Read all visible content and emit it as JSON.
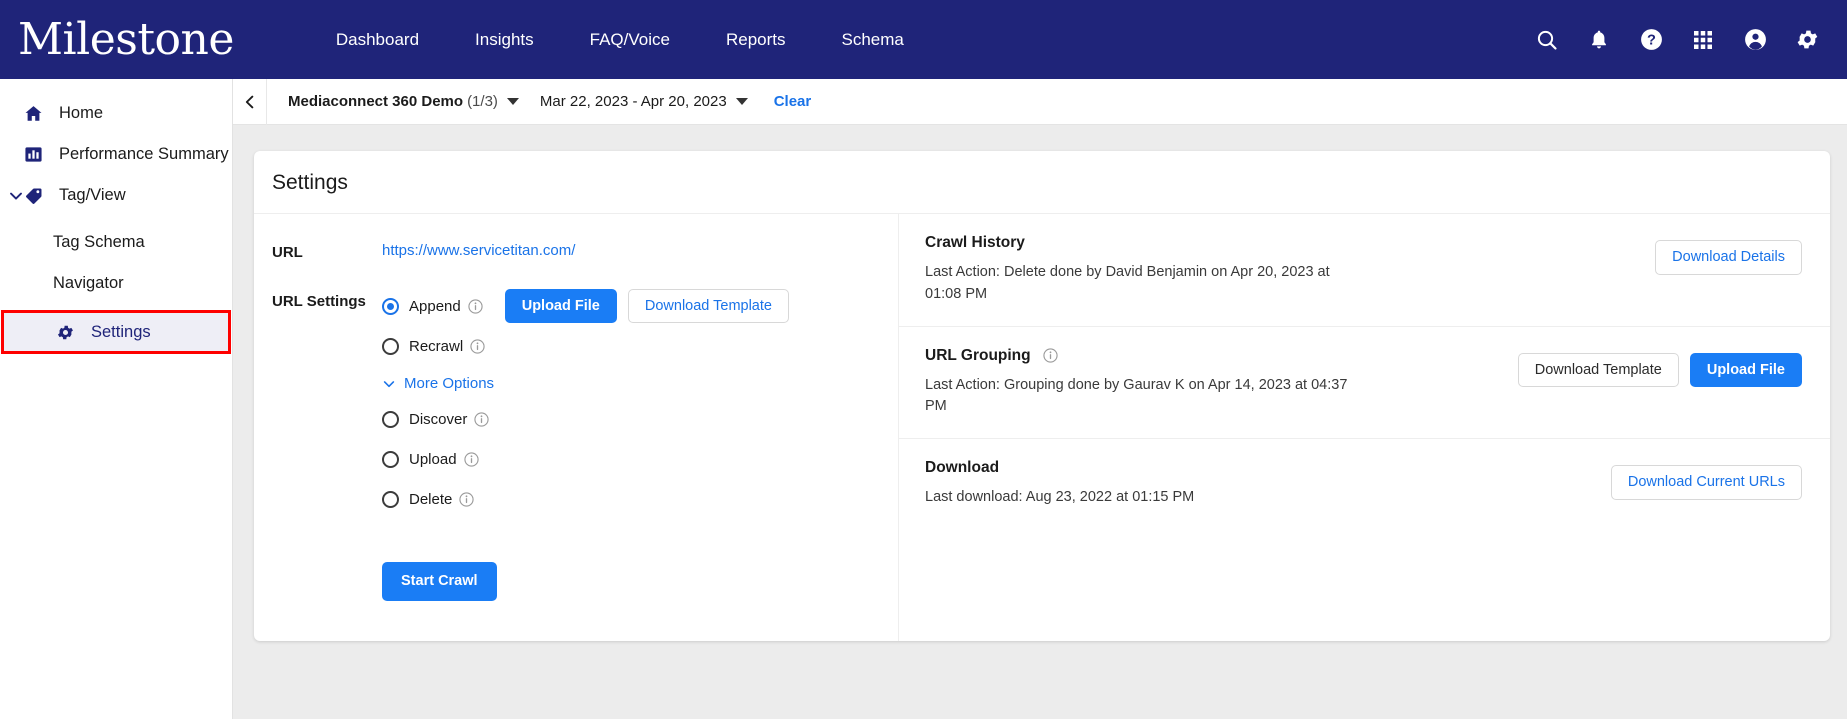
{
  "brand": {
    "logo_text": "Milestone",
    "navy": "#1f2479",
    "blue": "#1a73e8",
    "highlight_red": "#fe0000"
  },
  "topnav": {
    "links": [
      {
        "label": "Dashboard"
      },
      {
        "label": "Insights"
      },
      {
        "label": "FAQ/Voice"
      },
      {
        "label": "Reports"
      },
      {
        "label": "Schema"
      }
    ],
    "icons": [
      "search-icon",
      "bell-icon",
      "help-icon",
      "apps-grid-icon",
      "account-icon",
      "gear-icon"
    ]
  },
  "sidebar": {
    "items": [
      {
        "label": "Home",
        "icon": "home-icon",
        "level": 0,
        "selected": false
      },
      {
        "label": "Performance Summary",
        "icon": "bar-chart-icon",
        "level": 0,
        "selected": false
      },
      {
        "label": "Tag/View",
        "icon": "tag-icon",
        "level": 0,
        "selected": false,
        "expanded": true
      },
      {
        "label": "Tag Schema",
        "icon": "",
        "level": 1,
        "selected": false
      },
      {
        "label": "Navigator",
        "icon": "",
        "level": 1,
        "selected": false
      },
      {
        "label": "Settings",
        "icon": "gear-icon",
        "level": 1,
        "selected": true
      }
    ]
  },
  "filterbar": {
    "back": "chevron-left-icon",
    "project": "Mediaconnect 360 Demo",
    "project_count": "(1/3)",
    "date_range": "Mar 22, 2023 - Apr 20, 2023",
    "clear_label": "Clear"
  },
  "settings": {
    "title": "Settings",
    "url_label": "URL",
    "url_value": "https://www.servicetitan.com/",
    "url_settings_label": "URL Settings",
    "options": [
      {
        "label": "Append",
        "selected": true,
        "info": true
      },
      {
        "label": "Recrawl",
        "selected": false,
        "info": true
      },
      {
        "label": "Discover",
        "selected": false,
        "info": true
      },
      {
        "label": "Upload",
        "selected": false,
        "info": true
      },
      {
        "label": "Delete",
        "selected": false,
        "info": true
      }
    ],
    "upload_file_label": "Upload File",
    "download_template_label": "Download Template",
    "more_options_label": "More Options",
    "start_crawl_label": "Start Crawl"
  },
  "right_panel": {
    "crawl_history": {
      "title": "Crawl History",
      "last_action": "Last Action: Delete done by David Benjamin on Apr 20, 2023 at 01:08 PM",
      "button": "Download Details"
    },
    "url_grouping": {
      "title": "URL Grouping",
      "last_action": "Last Action: Grouping done by Gaurav K on Apr 14, 2023 at 04:37 PM",
      "download_template": "Download Template",
      "upload_file": "Upload File"
    },
    "download": {
      "title": "Download",
      "last_download": "Last download: Aug 23, 2022 at 01:15 PM",
      "button": "Download Current URLs"
    }
  }
}
